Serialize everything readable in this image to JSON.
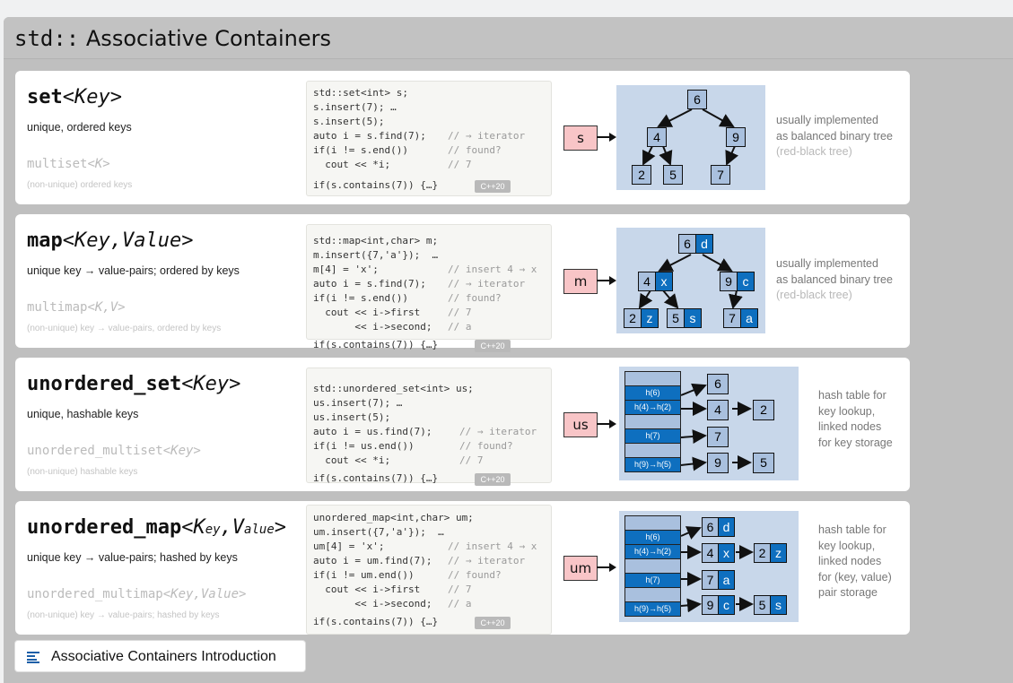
{
  "page": {
    "title_mono": "std::",
    "title_text": "Associative Containers"
  },
  "cards": [
    {
      "heading": "set",
      "params": "<Key>",
      "desc": "unique, ordered keys",
      "multi": "multiset",
      "multi_params": "<K>",
      "multi_note": "(non-unique)  ordered keys",
      "code": [
        {
          "c": "std::set<int> s;",
          "m": ""
        },
        {
          "c": "s.insert(7); …",
          "m": ""
        },
        {
          "c": "s.insert(5);",
          "m": ""
        },
        {
          "c": "auto i = s.find(7);",
          "m": "// → iterator"
        },
        {
          "c": "if(i != s.end())",
          "m": "// found?"
        },
        {
          "c": "  cout << *i;",
          "m": "// 7"
        },
        {
          "c": "if(s.contains(7)) {…}",
          "m": ""
        }
      ],
      "badge": "C++20",
      "var": "s",
      "note": [
        "usually implemented",
        "as balanced binary tree"
      ],
      "note_faint": "(red-black tree)",
      "nodes": {
        "root": "6",
        "l": "4",
        "r": "9",
        "ll": "2",
        "lr": "5",
        "rl": "7"
      }
    },
    {
      "heading": "map",
      "params": "<Key,Value>",
      "desc": "unique key → value-pairs; ordered by keys",
      "multi": "multimap",
      "multi_params": "<K,V>",
      "multi_note": "(non-unique)  key → value-pairs,  ordered by keys",
      "code": [
        {
          "c": "std::map<int,char> m;",
          "m": ""
        },
        {
          "c": "m.insert({7,'a'});  …",
          "m": ""
        },
        {
          "c": "m[4] = 'x';",
          "m": "// insert 4 → x"
        },
        {
          "c": "auto i = s.find(7);",
          "m": "// → iterator"
        },
        {
          "c": "if(i != s.end())",
          "m": "// found?"
        },
        {
          "c": "  cout << i->first",
          "m": "// 7"
        },
        {
          "c": "       << i->second;",
          "m": "// a"
        },
        {
          "c": "if(s.contains(7)) {…}",
          "m": ""
        }
      ],
      "badge": "C++20",
      "var": "m",
      "note": [
        "usually implemented",
        "as balanced binary tree"
      ],
      "note_faint": "(red-black tree)",
      "nodes": {
        "root": [
          "6",
          "d"
        ],
        "l": [
          "4",
          "x"
        ],
        "r": [
          "9",
          "c"
        ],
        "ll": [
          "2",
          "z"
        ],
        "lr": [
          "5",
          "s"
        ],
        "rl": [
          "7",
          "a"
        ]
      }
    },
    {
      "heading": "unordered_set",
      "params": "<Key>",
      "desc": "unique, hashable keys",
      "multi": "unordered_multiset",
      "multi_params": "<Key>",
      "multi_note": "(non-unique)  hashable  keys",
      "code": [
        {
          "c": "std::unordered_set<int> us;",
          "m": ""
        },
        {
          "c": "us.insert(7); …",
          "m": ""
        },
        {
          "c": "us.insert(5);",
          "m": ""
        },
        {
          "c": "auto i = us.find(7);",
          "m": "// → iterator"
        },
        {
          "c": "if(i != us.end())",
          "m": "// found?"
        },
        {
          "c": "  cout << *i;",
          "m": "// 7"
        },
        {
          "c": "if(s.contains(7)) {…}",
          "m": ""
        }
      ],
      "badge": "C++20",
      "var": "us",
      "note": [
        "hash table for",
        "key lookup,",
        "linked nodes",
        "for key storage"
      ],
      "buckets": [
        "h(6)",
        "h(4)→h(2)",
        "h(7)",
        "h(9)→h(5)"
      ],
      "chains": [
        [
          "6"
        ],
        [
          "4",
          "2"
        ],
        [
          "7"
        ],
        [
          "9",
          "5"
        ]
      ]
    },
    {
      "heading": "unordered_map",
      "params_k": "K",
      "params_ksub": "ey",
      "params_v": "V",
      "params_vsub": "alue",
      "desc": "unique key → value-pairs; hashed by keys",
      "multi": "unordered_multimap",
      "multi_params": "<Key,Value>",
      "multi_note": "(non-unique)  key → value-pairs;  hashed  by keys",
      "code": [
        {
          "c": "unordered_map<int,char> um;",
          "m": ""
        },
        {
          "c": "um.insert({7,'a'});  …",
          "m": ""
        },
        {
          "c": "um[4] = 'x';",
          "m": "// insert 4 → x"
        },
        {
          "c": "auto i = um.find(7);",
          "m": "// → iterator"
        },
        {
          "c": "if(i != um.end())",
          "m": "// found?"
        },
        {
          "c": "  cout << i->first",
          "m": "// 7"
        },
        {
          "c": "       << i->second;",
          "m": "// a"
        },
        {
          "c": "if(s.contains(7)) {…}",
          "m": ""
        }
      ],
      "badge": "C++20",
      "var": "um",
      "note": [
        "hash table for",
        "key lookup,",
        "linked nodes",
        "for (key, value)",
        "pair storage"
      ],
      "buckets": [
        "h(6)",
        "h(4)→h(2)",
        "h(7)",
        "h(9)→h(5)"
      ],
      "chains": [
        [
          [
            "6",
            "d"
          ]
        ],
        [
          [
            "4",
            "x"
          ],
          [
            "2",
            "z"
          ]
        ],
        [
          [
            "7",
            "a"
          ]
        ],
        [
          [
            "9",
            "c"
          ],
          [
            "5",
            "s"
          ]
        ]
      ]
    }
  ],
  "footer_link": {
    "icon": "list-icon",
    "label": "Associative Containers Introduction"
  },
  "colors": {
    "diagram_bg": "#c8d7ea",
    "key_box": "#a9c0de",
    "value_box": "#0e6fbf",
    "var_box": "#f8c5c7"
  }
}
